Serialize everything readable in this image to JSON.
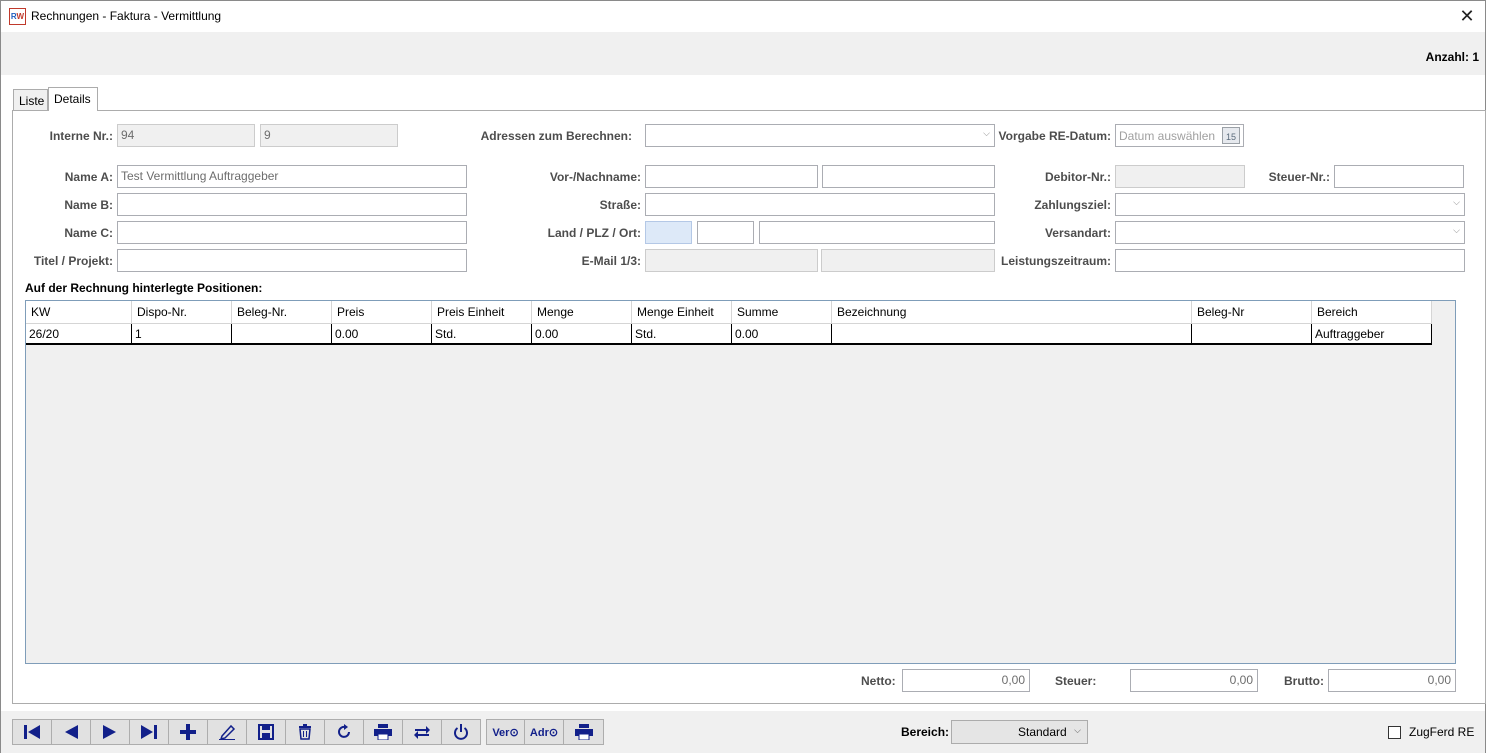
{
  "window": {
    "title": "Rechnungen - Faktura - Vermittlung",
    "count_label": "Anzahl: 1"
  },
  "tabs": [
    {
      "label": "Liste"
    },
    {
      "label": "Details"
    }
  ],
  "form": {
    "interne_nr_label": "Interne Nr.:",
    "interne_nr_value": "94",
    "interne_nr_value2": "9",
    "name_a_label": "Name A:",
    "name_a_value": "Test Vermittlung Auftraggeber",
    "name_b_label": "Name B:",
    "name_c_label": "Name C:",
    "titel_label": "Titel / Projekt:",
    "adressen_label": "Adressen zum Berechnen:",
    "vorname_label": "Vor-/Nachname:",
    "strasse_label": "Straße:",
    "land_label": "Land / PLZ / Ort:",
    "email_label": "E-Mail 1/3:",
    "vorgabe_label": "Vorgabe RE-Datum:",
    "vorgabe_placeholder": "Datum auswählen",
    "debitor_label": "Debitor-Nr.:",
    "steuer_nr_label": "Steuer-Nr.:",
    "zahlungsziel_label": "Zahlungsziel:",
    "versandart_label": "Versandart:",
    "leistung_label": "Leistungszeitraum:"
  },
  "positions": {
    "title": "Auf der Rechnung hinterlegte Positionen:",
    "columns": [
      "KW",
      "Dispo-Nr.",
      "Beleg-Nr.",
      "Preis",
      "Preis Einheit",
      "Menge",
      "Menge Einheit",
      "Summe",
      "Bezeichnung",
      "Beleg-Nr",
      "Bereich"
    ],
    "rows": [
      [
        "26/20",
        "1",
        "",
        "0.00",
        "Std.",
        "0.00",
        "Std.",
        "0.00",
        "",
        "",
        "Auftraggeber"
      ]
    ]
  },
  "totals": {
    "netto_label": "Netto:",
    "netto_value": "0,00",
    "steuer_label": "Steuer:",
    "steuer_value": "0,00",
    "brutto_label": "Brutto:",
    "brutto_value": "0,00"
  },
  "footer": {
    "ver_label": "Ver⊙",
    "adr_label": "Adr⊙",
    "bereich_label": "Bereich:",
    "bereich_value": "Standard",
    "zugferd_label": "ZugFerd RE"
  },
  "colors": {
    "accent": "#12208a",
    "grid_border": "#7f9db9",
    "panel_bg": "#f0f0f0"
  }
}
